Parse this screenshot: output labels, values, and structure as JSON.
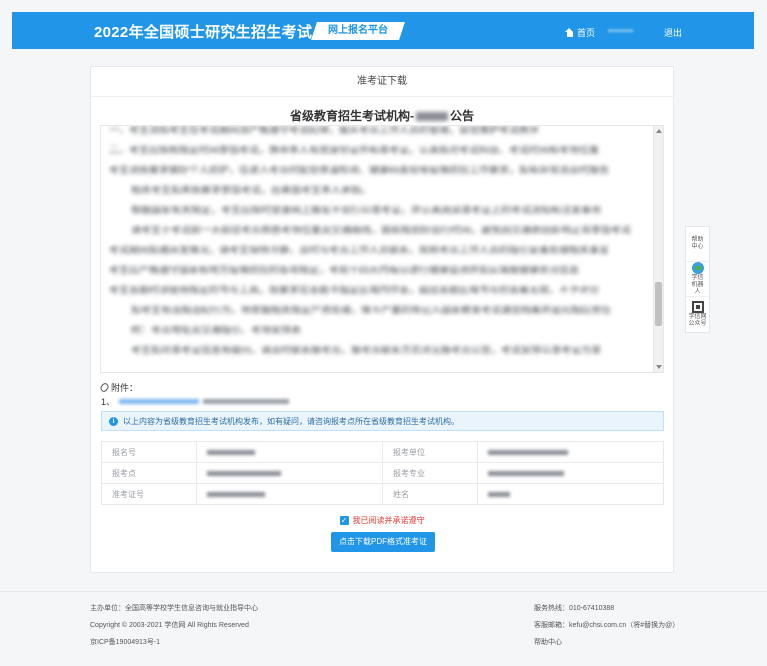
{
  "header": {
    "brand": "2022年全国硕士研究生招生考试",
    "platform_tag": "网上报名平台",
    "nav_home": "首页",
    "nav_user": "••••••••",
    "nav_logout": "退出"
  },
  "card": {
    "title": "准考证下载",
    "notice_title_prefix": "省级教育招生考试机构-",
    "notice_title_suffix": "公告",
    "notice_lines": [
      "一、考生须知考生在考试期间须严格遵守考试纪律，服从考点工作人员的管理，自觉维护考试秩序",
      "二、考生应按照规定时间参加考试，携带本人有效身份证件和准考证，认真核对考试科目、考试时间和考场位置",
      "考生须按要求做好个人防护，在进入考点时配合体温检测、健康码查验等疫情防控工作要求，如有异常须及时报告",
      "相关考生如未按要求参加考试，后果由考生本人承担。",
      "根据国家有关规定，考生应按时登录网上报名平台打印准考证，并认真阅读准考证上的考试须知和注意事项",
      "请考生于考试前一天前往考点熟悉考场位置及交通路线，提前规划好出行时间，避免因交通原因影响正常参加考试",
      "考试期间如遇突发情况，请考生保持冷静，及时与考点工作人员联系，按照考点工作人员的指引妥善处理相关事宜",
      "考生应严格遵守国家和地方疫情防控的各项规定，考前十四天内每日进行健康监测并如实填报健康状况信息",
      "考生答题时须使用规定的书写工具，按要求在答题卡指定区域内作答，超出答题区域书写的答案无效，不予评分",
      "如考生有违规违纪行为，将依据相关规定严肃处理，情节严重的将记入国家教育考试诚信档案并追究相应责任",
      "附：考点地址及交通指引、考场安排表",
      "考生如对准考证信息有疑问，请及时联系报考点，报考点联系方式详见报考点公告，考试安排以准考证为准"
    ],
    "attachment_label": "附件：",
    "attachment_item_prefix": "1、",
    "info_text": "以上内容为省级教育招生考试机构发布，如有疑问，请咨询报考点所在省级教育招生考试机构。",
    "details": [
      {
        "label_left": "报名号",
        "label_right": "报考单位"
      },
      {
        "label_left": "报考点",
        "label_right": "报考专业"
      },
      {
        "label_left": "准考证号",
        "label_right": "姓名"
      }
    ],
    "agree_text": "我已阅读并承诺遵守",
    "download_button": "点击下载PDF格式准考证"
  },
  "sidebar": {
    "help": "帮助中心",
    "robot": "学信机器人",
    "wechat": "学信网公众号"
  },
  "footer": {
    "sponsor": "主办单位：全国高等学校学生信息咨询与就业指导中心",
    "copyright": "Copyright © 2003-2021 学信网 All Rights Reserved",
    "icp": "京ICP备19004913号-1",
    "hotline": "服务热线：010-67410388",
    "email": "客服邮箱：kefu@chsi.com.cn（将#替换为@）",
    "help": "帮助中心"
  }
}
